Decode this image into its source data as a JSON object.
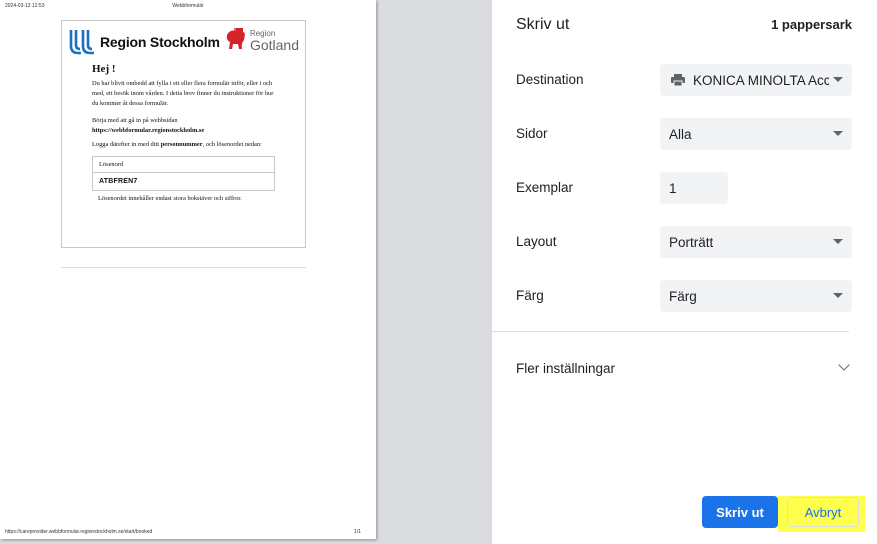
{
  "preview": {
    "header_timestamp": "2024-03-13 12:53",
    "header_title": "Webbformulär",
    "footer_url": "https://careprovider.webbformular.regionstockholm.se/start/booked",
    "footer_page": "1/1",
    "logo_left": "Region Stockholm",
    "logo_right_line1": "Region",
    "logo_right_line2": "Gotland",
    "greeting": "Hej !",
    "para1": "Du har blivit ombedd att fylla i ett eller flera formulär inför, eller i och med, ett besök inom vården. I detta brev finner du instruktioner för hur du kommer åt dessa formulär.",
    "para2_line1": "Börja med att gå in på webbsidan",
    "para2_url": "https://webbformular.regionstockholm.se",
    "para3_pre": "Logga därefter in med ditt ",
    "para3_bold": "personnummer",
    "para3_post": ", och lösenordet nedan:",
    "password_label": "Lösenord",
    "password_value": "ATBFREN7",
    "password_note": "Lösenordet innehåller endast stora bokstäver och siffror."
  },
  "panel": {
    "title": "Skriv ut",
    "sheet_count": "1 pappersark",
    "destination": {
      "label": "Destination",
      "value": "KONICA MINOLTA Acc"
    },
    "pages": {
      "label": "Sidor",
      "value": "Alla"
    },
    "copies": {
      "label": "Exemplar",
      "value": "1"
    },
    "layout": {
      "label": "Layout",
      "value": "Porträtt"
    },
    "color": {
      "label": "Färg",
      "value": "Färg"
    },
    "more_settings": "Fler inställningar",
    "print_button": "Skriv ut",
    "cancel_button": "Avbryt"
  },
  "colors": {
    "accent": "#1a73e8",
    "highlight": "#ffff2e",
    "preview_bg": "#dadce0",
    "select_bg": "#f1f3f4"
  }
}
